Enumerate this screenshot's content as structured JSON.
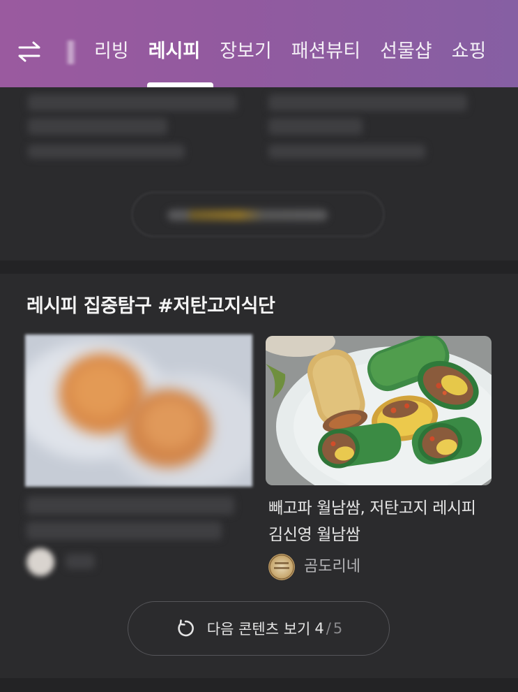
{
  "topbar": {
    "tabs": [
      {
        "label": "리빙",
        "active": false
      },
      {
        "label": "레시피",
        "active": true
      },
      {
        "label": "장보기",
        "active": false
      },
      {
        "label": "패션뷰티",
        "active": false
      },
      {
        "label": "선물샵",
        "active": false
      },
      {
        "label": "쇼핑",
        "active": false
      }
    ],
    "switch_icon": "swap-arrows-icon",
    "colors": {
      "gradient_start": "#9a5a9f",
      "gradient_end": "#865fa3"
    }
  },
  "recipe_section": {
    "title": "레시피 집중탐구 #저탄고지식단",
    "cards": [
      {
        "blurred": true
      },
      {
        "title": "빼고파 월남쌈, 저탄고지 레시피 김신영 월남쌈",
        "author": "곰도리네"
      }
    ],
    "more_button": {
      "label": "다음 콘텐츠 보기",
      "current_page": "4",
      "separator": "/",
      "total_pages": "5",
      "icon": "refresh-icon"
    }
  }
}
